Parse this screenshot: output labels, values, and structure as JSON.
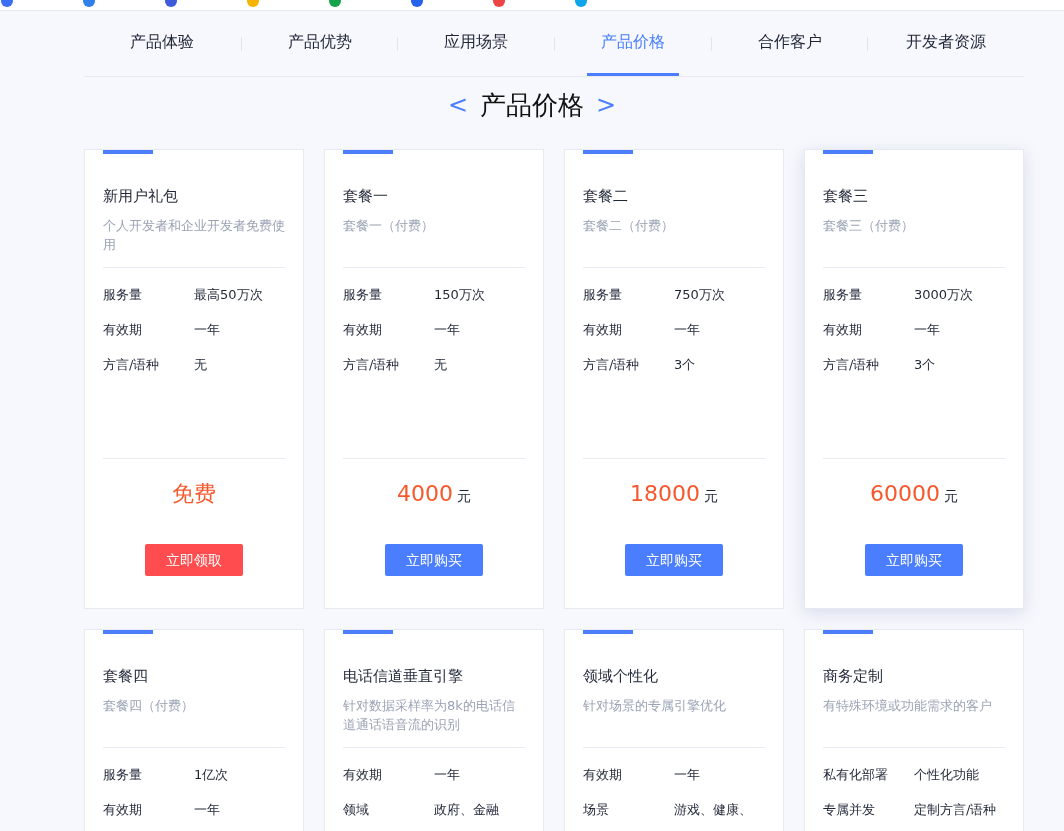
{
  "nav": {
    "tabs": [
      {
        "label": "产品体验",
        "selected": false
      },
      {
        "label": "产品优势",
        "selected": false
      },
      {
        "label": "应用场景",
        "selected": false
      },
      {
        "label": "产品价格",
        "selected": true
      },
      {
        "label": "合作客户",
        "selected": false
      },
      {
        "label": "开发者资源",
        "selected": false
      }
    ]
  },
  "section": {
    "prev": "<",
    "title": "产品价格",
    "next": ">"
  },
  "cards": [
    {
      "title": "新用户礼包",
      "description": "个人开发者和企业开发者免费使用",
      "hovered": false,
      "rows": [
        {
          "label": "服务量",
          "value": "最高50万次"
        },
        {
          "label": "有效期",
          "value": "一年"
        },
        {
          "label": "方言/语种",
          "value": "无"
        }
      ],
      "price": "免费",
      "button": {
        "kind": "free",
        "label": "立即领取"
      }
    },
    {
      "title": "套餐一",
      "description": "套餐一（付费）",
      "hovered": false,
      "rows": [
        {
          "label": "服务量",
          "value": "150万次"
        },
        {
          "label": "有效期",
          "value": "一年"
        },
        {
          "label": "方言/语种",
          "value": "无"
        }
      ],
      "price": "4000",
      "unit": "元",
      "button": {
        "kind": "buy",
        "label": "立即购买"
      }
    },
    {
      "title": "套餐二",
      "description": "套餐二（付费）",
      "hovered": false,
      "rows": [
        {
          "label": "服务量",
          "value": "750万次"
        },
        {
          "label": "有效期",
          "value": "一年"
        },
        {
          "label": "方言/语种",
          "value": "3个"
        }
      ],
      "price": "18000",
      "unit": "元",
      "button": {
        "kind": "buy",
        "label": "立即购买"
      }
    },
    {
      "title": "套餐三",
      "description": "套餐三（付费）",
      "hovered": true,
      "rows": [
        {
          "label": "服务量",
          "value": "3000万次"
        },
        {
          "label": "有效期",
          "value": "一年"
        },
        {
          "label": "方言/语种",
          "value": "3个"
        }
      ],
      "price": "60000",
      "unit": "元",
      "button": {
        "kind": "buy",
        "label": "立即购买"
      }
    },
    {
      "title": "套餐四",
      "description": "套餐四（付费）",
      "hovered": false,
      "rows": [
        {
          "label": "服务量",
          "value": "1亿次"
        },
        {
          "label": "有效期",
          "value": "一年"
        }
      ]
    },
    {
      "title": "电话信道垂直引擎",
      "description": "针对数据采样率为8k的电话信道通话语音流的识别",
      "hovered": false,
      "rows": [
        {
          "label": "有效期",
          "value": "一年"
        },
        {
          "label": "领域",
          "value": "政府、金融"
        }
      ]
    },
    {
      "title": "领域个性化",
      "description": "针对场景的专属引擎优化",
      "hovered": false,
      "rows": [
        {
          "label": "有效期",
          "value": "一年"
        },
        {
          "label": "场景",
          "value": "游戏、健康、"
        }
      ]
    },
    {
      "title": "商务定制",
      "description": "有特殊环境或功能需求的客户",
      "hovered": false,
      "rows": [
        {
          "label": "私有化部署",
          "value": "个性化功能"
        },
        {
          "label": "专属并发",
          "value": "定制方言/语种"
        }
      ]
    }
  ]
}
